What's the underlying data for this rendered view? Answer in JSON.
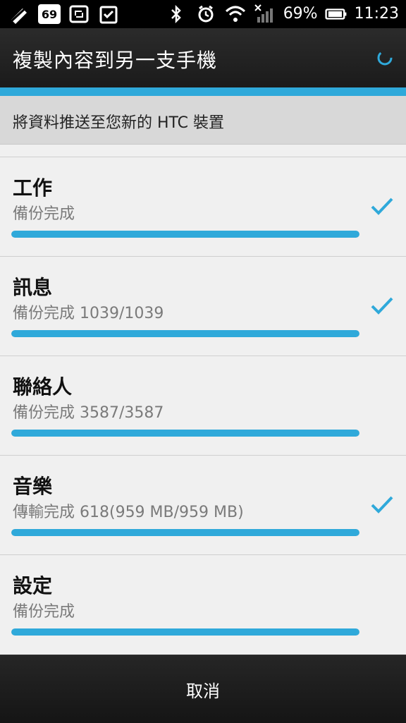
{
  "status_bar": {
    "left_icons": [
      "pen-off-icon",
      "calendar-69-icon",
      "sync-icon",
      "clipboard-check-icon"
    ],
    "calendar_badge": "69",
    "right_icons": [
      "bluetooth-icon",
      "alarm-icon",
      "wifi-icon",
      "no-signal-icon",
      "battery-icon"
    ],
    "battery_percent": "69%",
    "time": "11:23"
  },
  "header": {
    "title": "複製內容到另一支手機"
  },
  "subheader": {
    "text": "將資料推送至您新的 HTC 裝置"
  },
  "items": [
    {
      "name": "工作",
      "status": "備份完成",
      "progress": 100,
      "checked": true
    },
    {
      "name": "訊息",
      "status": "備份完成 1039/1039",
      "progress": 100,
      "checked": true
    },
    {
      "name": "聯絡人",
      "status": "備份完成 3587/3587",
      "progress": 100,
      "checked": false
    },
    {
      "name": "音樂",
      "status": "傳輸完成 618(959 MB/959 MB)",
      "progress": 100,
      "checked": true
    },
    {
      "name": "設定",
      "status": "備份完成",
      "progress": 100,
      "checked": false
    }
  ],
  "footer": {
    "cancel_label": "取消"
  },
  "colors": {
    "accent": "#2fa9da",
    "background": "#f0f0f0",
    "header_dark": "#1b1b1b"
  }
}
